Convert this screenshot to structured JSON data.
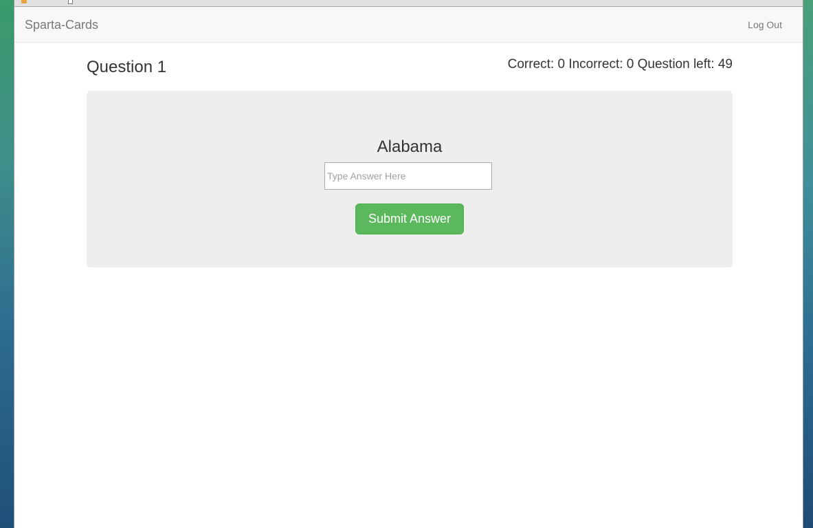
{
  "app": {
    "brand": "Sparta-Cards"
  },
  "nav": {
    "logout_label": "Log Out"
  },
  "question": {
    "title": "Question 1",
    "prompt": "Alabama"
  },
  "score": {
    "text": "Correct: 0 Incorrect: 0 Question left: 49"
  },
  "answer": {
    "placeholder": "Type Answer Here",
    "value": ""
  },
  "actions": {
    "submit_label": "Submit Answer"
  },
  "colors": {
    "accent_green": "#5cb85c",
    "navbar_bg": "#f8f8f8",
    "card_bg": "#eeeeee",
    "text": "#333333",
    "muted_text": "#777777"
  }
}
